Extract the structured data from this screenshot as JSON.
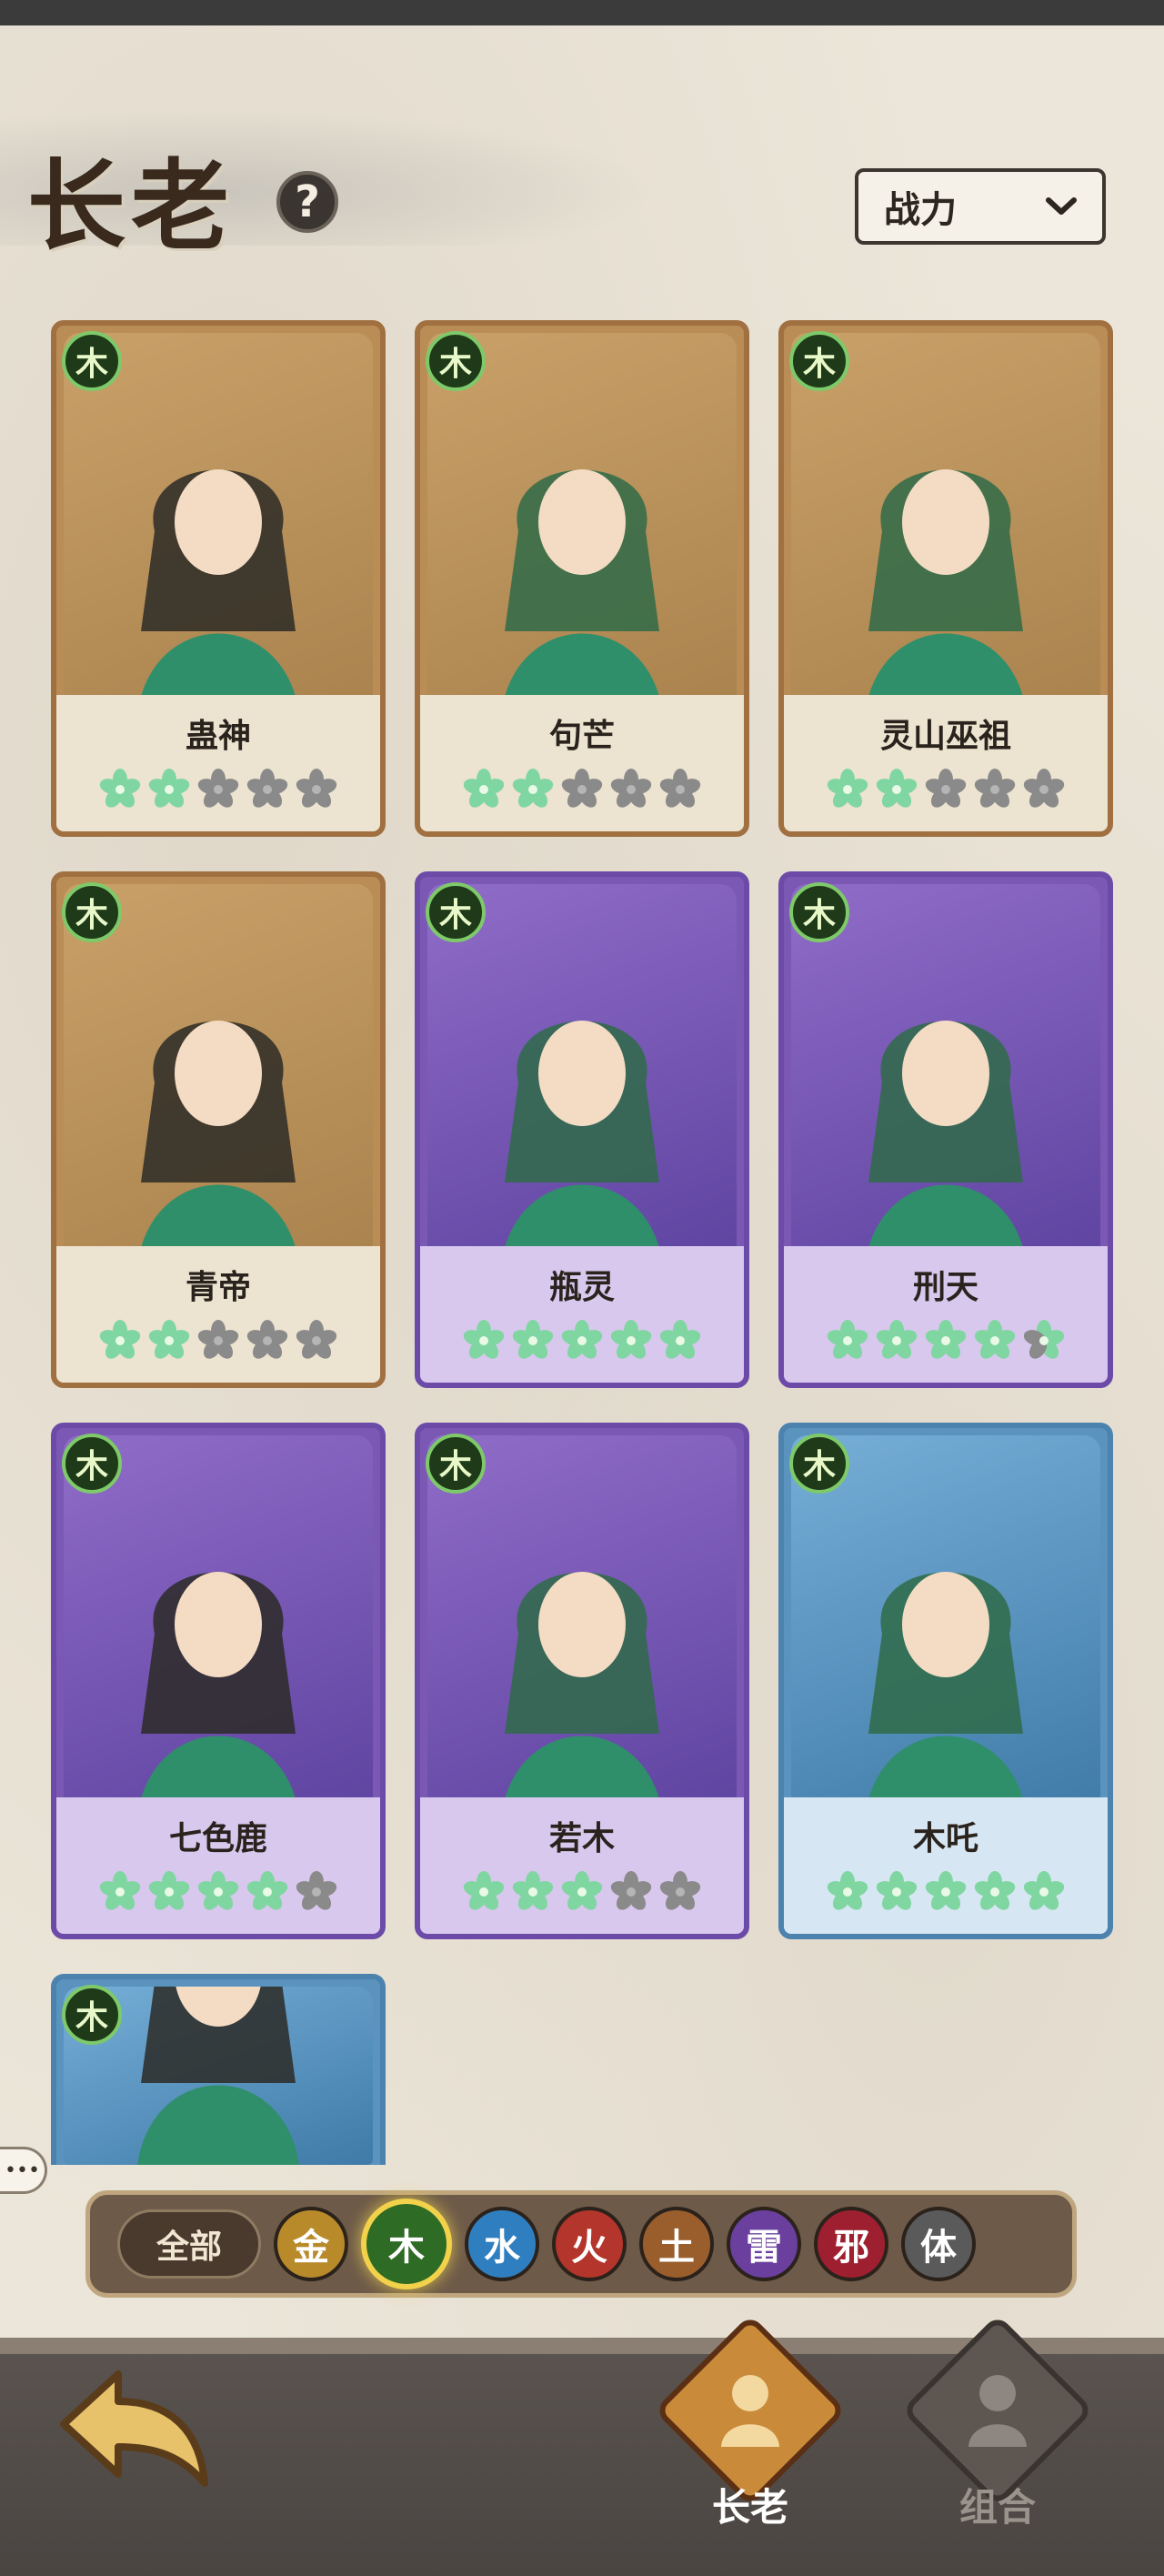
{
  "header": {
    "title": "长老",
    "help_symbol": "?",
    "sort_label": "战力"
  },
  "colors": {
    "gold_card": "#b98d55",
    "purple_card": "#7a58b3",
    "blue_card": "#5a93be",
    "star_on": "#7fd6a0",
    "star_off": "#8a8a8a"
  },
  "element_badge": "木",
  "cards": [
    {
      "name": "蛊神",
      "rarity": "gold",
      "stars": 2
    },
    {
      "name": "句芒",
      "rarity": "gold",
      "stars": 2
    },
    {
      "name": "灵山巫祖",
      "rarity": "gold",
      "stars": 2
    },
    {
      "name": "青帝",
      "rarity": "gold",
      "stars": 2
    },
    {
      "name": "瓶灵",
      "rarity": "purple",
      "stars": 5
    },
    {
      "name": "刑天",
      "rarity": "purple",
      "stars": 4.5
    },
    {
      "name": "七色鹿",
      "rarity": "purple",
      "stars": 4
    },
    {
      "name": "若木",
      "rarity": "purple",
      "stars": 3
    },
    {
      "name": "木吒",
      "rarity": "blue",
      "stars": 5
    },
    {
      "name": "",
      "rarity": "blue",
      "stars": 0
    }
  ],
  "filters": {
    "all_label": "全部",
    "elements": [
      {
        "label": "金",
        "color": "#b88a2a",
        "active": false
      },
      {
        "label": "木",
        "color": "#2e6b24",
        "active": true
      },
      {
        "label": "水",
        "color": "#2f7fc0",
        "active": false
      },
      {
        "label": "火",
        "color": "#b3352b",
        "active": false
      },
      {
        "label": "土",
        "color": "#9a5e2c",
        "active": false
      },
      {
        "label": "雷",
        "color": "#6a3f9e",
        "active": false
      },
      {
        "label": "邪",
        "color": "#9e2030",
        "active": false
      },
      {
        "label": "体",
        "color": "#5a5a5a",
        "active": false
      }
    ]
  },
  "bottom_nav": {
    "elders_label": "长老",
    "combo_label": "组合"
  }
}
